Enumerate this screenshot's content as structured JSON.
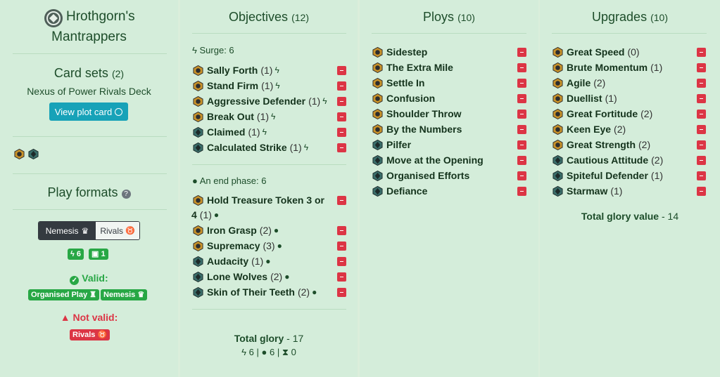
{
  "warband": {
    "name_line1": "Hrothgorn's",
    "name_line2": "Mantrappers"
  },
  "card_sets": {
    "title": "Card sets",
    "count": "(2)",
    "set_name": "Nexus of Power Rivals Deck",
    "view_plot_label": "View plot card"
  },
  "play_formats": {
    "title": "Play formats",
    "tabs": [
      {
        "label": "Nemesis"
      },
      {
        "label": "Rivals"
      }
    ],
    "surge_limit": "6",
    "restricted_limit": "1",
    "valid_label": "Valid:",
    "valid_badges": [
      "Organised Play",
      "Nemesis"
    ],
    "not_valid_label": "Not valid:",
    "not_valid_badges": [
      "Rivals"
    ]
  },
  "objectives": {
    "title": "Objectives",
    "count": "(12)",
    "surge_label": "Surge: 6",
    "surge_items": [
      {
        "name": "Sally Forth",
        "count": "(1)",
        "faction": "gold"
      },
      {
        "name": "Stand Firm",
        "count": "(1)",
        "faction": "gold"
      },
      {
        "name": "Aggressive Defender",
        "count": "(1)",
        "faction": "gold"
      },
      {
        "name": "Break Out",
        "count": "(1)",
        "faction": "gold"
      },
      {
        "name": "Claimed",
        "count": "(1)",
        "faction": "teal"
      },
      {
        "name": "Calculated Strike",
        "count": "(1)",
        "faction": "teal"
      }
    ],
    "end_label": "An end phase: 6",
    "end_items": [
      {
        "name": "Hold Treasure Token 3 or",
        "name2": "4",
        "count": "(1)",
        "faction": "gold"
      },
      {
        "name": "Iron Grasp",
        "count": "(2)",
        "faction": "gold"
      },
      {
        "name": "Supremacy",
        "count": "(3)",
        "faction": "gold"
      },
      {
        "name": "Audacity",
        "count": "(1)",
        "faction": "teal"
      },
      {
        "name": "Lone Wolves",
        "count": "(2)",
        "faction": "teal"
      },
      {
        "name": "Skin of Their Teeth",
        "count": "(2)",
        "faction": "teal"
      }
    ],
    "total_label": "Total glory",
    "total_value": "- 17",
    "summary": {
      "surge": "6",
      "end": "6",
      "third": "0"
    }
  },
  "ploys": {
    "title": "Ploys",
    "count": "(10)",
    "items": [
      {
        "name": "Sidestep",
        "faction": "gold"
      },
      {
        "name": "The Extra Mile",
        "faction": "gold"
      },
      {
        "name": "Settle In",
        "faction": "gold"
      },
      {
        "name": "Confusion",
        "faction": "gold"
      },
      {
        "name": "Shoulder Throw",
        "faction": "gold"
      },
      {
        "name": "By the Numbers",
        "faction": "gold"
      },
      {
        "name": "Pilfer",
        "faction": "teal"
      },
      {
        "name": "Move at the Opening",
        "faction": "teal"
      },
      {
        "name": "Organised Efforts",
        "faction": "teal"
      },
      {
        "name": "Defiance",
        "faction": "teal"
      }
    ]
  },
  "upgrades": {
    "title": "Upgrades",
    "count": "(10)",
    "items": [
      {
        "name": "Great Speed",
        "count": "(0)",
        "faction": "gold"
      },
      {
        "name": "Brute Momentum",
        "count": "(1)",
        "faction": "gold"
      },
      {
        "name": "Agile",
        "count": "(2)",
        "faction": "gold"
      },
      {
        "name": "Duellist",
        "count": "(1)",
        "faction": "gold"
      },
      {
        "name": "Great Fortitude",
        "count": "(2)",
        "faction": "gold"
      },
      {
        "name": "Keen Eye",
        "count": "(2)",
        "faction": "gold"
      },
      {
        "name": "Great Strength",
        "count": "(2)",
        "faction": "gold"
      },
      {
        "name": "Cautious Attitude",
        "count": "(2)",
        "faction": "teal"
      },
      {
        "name": "Spiteful Defender",
        "count": "(1)",
        "faction": "teal"
      },
      {
        "name": "Starmaw",
        "count": "(1)",
        "faction": "teal"
      }
    ],
    "total_label": "Total glory value",
    "total_value": "- 14"
  },
  "colors": {
    "panel": "#d4edda",
    "remove": "#dc3545",
    "valid": "#28a745",
    "view_button": "#17a2b8",
    "gold_icon": "#c8922a",
    "teal_icon": "#3a6e6a"
  }
}
